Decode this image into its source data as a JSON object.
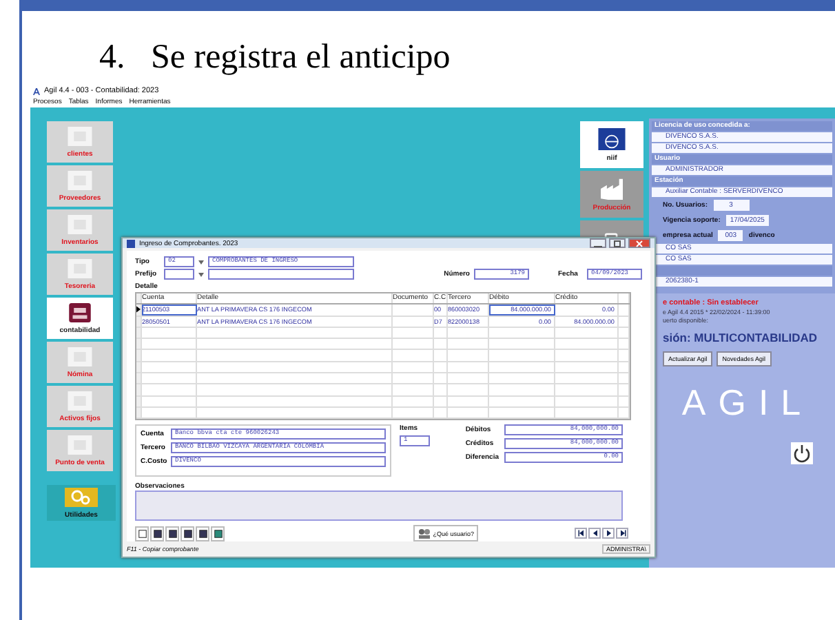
{
  "slide_title": "4.   Se registra el anticipo",
  "window": {
    "title": "Agil 4.4 - 003 - Contabilidad: 2023",
    "menu": [
      "Procesos",
      "Tablas",
      "Informes",
      "Herramientas"
    ]
  },
  "sidebar": {
    "items": [
      {
        "label": "clientes",
        "selected": false
      },
      {
        "label": "Proveedores",
        "selected": false
      },
      {
        "label": "Inventarios",
        "selected": false
      },
      {
        "label": "Tesoreria",
        "selected": false
      },
      {
        "label": "contabilidad",
        "selected": true
      },
      {
        "label": "Nómina",
        "selected": false
      },
      {
        "label": "Activos fijos",
        "selected": false
      },
      {
        "label": "Punto de venta",
        "selected": false
      }
    ],
    "utilities": {
      "label": "Utilidades"
    }
  },
  "modules": [
    {
      "label": "niif",
      "kind": "niif"
    },
    {
      "label": "Producción",
      "kind": "factory"
    },
    {
      "kind": "phone"
    }
  ],
  "license_panel": {
    "rows": [
      {
        "kind": "heading",
        "text": "Licencia de uso concedida a:"
      },
      {
        "kind": "field",
        "text": "DIVENCO S.A.S."
      },
      {
        "kind": "field",
        "text": "DIVENCO S.A.S."
      },
      {
        "kind": "heading",
        "text": "Usuario"
      },
      {
        "kind": "field",
        "text": "ADMINISTRADOR"
      },
      {
        "kind": "heading",
        "text": "Estación"
      },
      {
        "kind": "field",
        "text": "Auxiliar Contable : SERVERDIVENCO"
      },
      {
        "kind": "pair",
        "label": "No. Usuarios:",
        "value": "3"
      },
      {
        "kind": "pair",
        "label": "Vigencia soporte:",
        "value": "17/04/2025"
      },
      {
        "kind": "company",
        "label": "empresa actual",
        "value": "003",
        "name": "divenco"
      },
      {
        "kind": "field",
        "text": "CO SAS"
      },
      {
        "kind": "field",
        "text": "CO SAS"
      },
      {
        "kind": "heading",
        "text": ""
      },
      {
        "kind": "field",
        "text": "2062380-1"
      }
    ],
    "contable": "e contable  : Sin establecer",
    "version_lines": [
      "e Agil 4.4 2015 * 22/02/2024 - 11:39:00",
      "uerto disponible:"
    ],
    "edition": "sión: MULTICONTABILIDAD",
    "buttons": [
      "Actualizar Agil",
      "Novedades Agil"
    ],
    "logo": "AGIL"
  },
  "dialog": {
    "title": "Ingreso de Comprobantes. 2023",
    "tipo_label": "Tipo",
    "tipo_code": "02",
    "tipo_name": "COMPROBANTES DE INGRESO",
    "prefijo_label": "Prefijo",
    "numero_label": "Número",
    "numero": "3179",
    "fecha_label": "Fecha",
    "fecha": "04/09/2023",
    "detalle_label": "Detalle",
    "table": {
      "columns": [
        "Cuenta",
        "Detalle",
        "Documento",
        "C.C",
        "Tercero",
        "Débito",
        "Crédito"
      ],
      "rows": [
        {
          "selected": true,
          "cells": [
            "21100503",
            "ANT LA PRIMAVERA CS 176 INGECOM",
            "",
            "00",
            "860003020",
            "84.000.000.00",
            "0.00"
          ]
        },
        {
          "selected": false,
          "cells": [
            "28050501",
            "ANT LA PRIMAVERA CS 176 INGECOM",
            "",
            "D7",
            "822000138",
            "0.00",
            "84.000.000.00"
          ]
        }
      ]
    },
    "details": [
      {
        "label": "Cuenta",
        "value": "Banco bbva cta cte 960026243"
      },
      {
        "label": "Tercero",
        "value": "BANCO BILBAO VIZCAYA ARGENTARIA COLOMBIA"
      },
      {
        "label": "C.Costo",
        "value": "DIVENCO"
      }
    ],
    "items_label": "Items",
    "items": "1",
    "totals": [
      {
        "label": "Débitos",
        "value": "84,000,000.00"
      },
      {
        "label": "Créditos",
        "value": "84,000,000.00"
      },
      {
        "label": "Diferencia",
        "value": "0.00"
      }
    ],
    "observaciones_label": "Observaciones",
    "user_button": "¿Qué usuario?",
    "status": "F11 - Copiar comprobante",
    "status_user": "ADMINISTRA\\"
  }
}
